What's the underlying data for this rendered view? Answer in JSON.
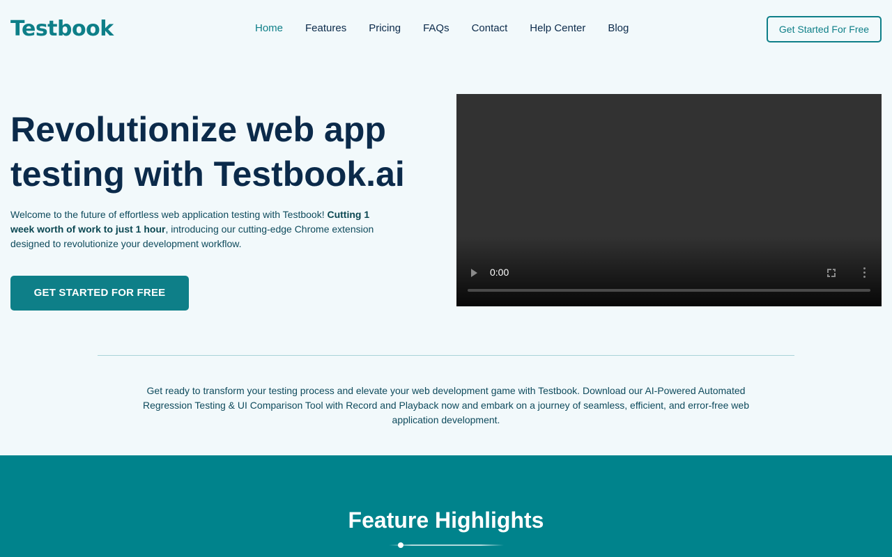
{
  "header": {
    "logo": "Testbook",
    "nav": [
      {
        "label": "Home"
      },
      {
        "label": "Features"
      },
      {
        "label": "Pricing"
      },
      {
        "label": "FAQs"
      },
      {
        "label": "Contact"
      },
      {
        "label": "Help Center"
      },
      {
        "label": "Blog"
      }
    ],
    "active_nav": "Home",
    "cta_label": "Get Started For Free"
  },
  "hero": {
    "title_line1": "Revolutionize web app",
    "title_line2": "testing with Testbook.ai",
    "desc_part1": "Welcome to the future of effortless web application testing with Testbook! ",
    "desc_bold": "Cutting 1 week worth of work to just 1 hour",
    "desc_part2": ", introducing our cutting-edge Chrome extension designed to revolutionize your development workflow.",
    "cta_label": "GET STARTED FOR FREE"
  },
  "video": {
    "time": "0:00",
    "progress": 0
  },
  "intro": {
    "text": "Get ready to transform your testing process and elevate your web development game with Testbook. Download our AI-Powered Automated Regression Testing & UI Comparison Tool with Record and Playback now and embark on a journey of seamless, efficient, and error-free web application development."
  },
  "features": {
    "title": "Feature Highlights"
  },
  "colors": {
    "brand": "#0e7f88",
    "heading": "#0b2a4a",
    "band": "#00838c",
    "page_bg": "#f2f9fb"
  }
}
